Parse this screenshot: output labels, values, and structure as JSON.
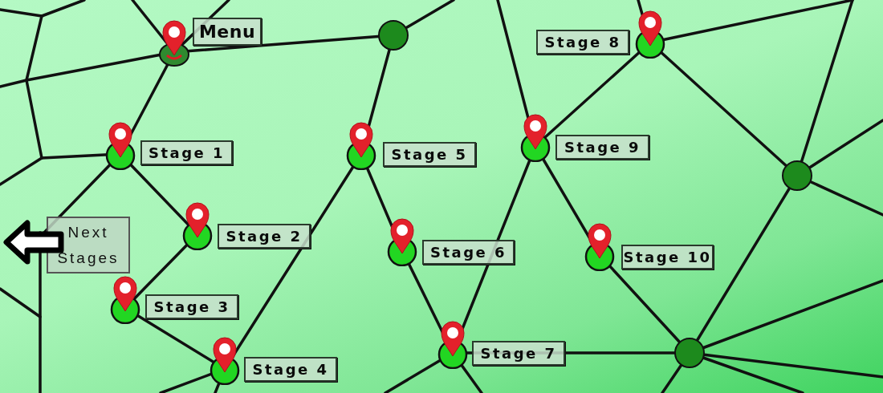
{
  "menu": {
    "label": "Menu"
  },
  "next_button": {
    "label": "Next Stages"
  },
  "stages": [
    {
      "label": "Stage 1"
    },
    {
      "label": "Stage 2"
    },
    {
      "label": "Stage 3"
    },
    {
      "label": "Stage 4"
    },
    {
      "label": "Stage 5"
    },
    {
      "label": "Stage 6"
    },
    {
      "label": "Stage 7"
    },
    {
      "label": "Stage 8"
    },
    {
      "label": "Stage 9"
    },
    {
      "label": "Stage 10"
    }
  ]
}
